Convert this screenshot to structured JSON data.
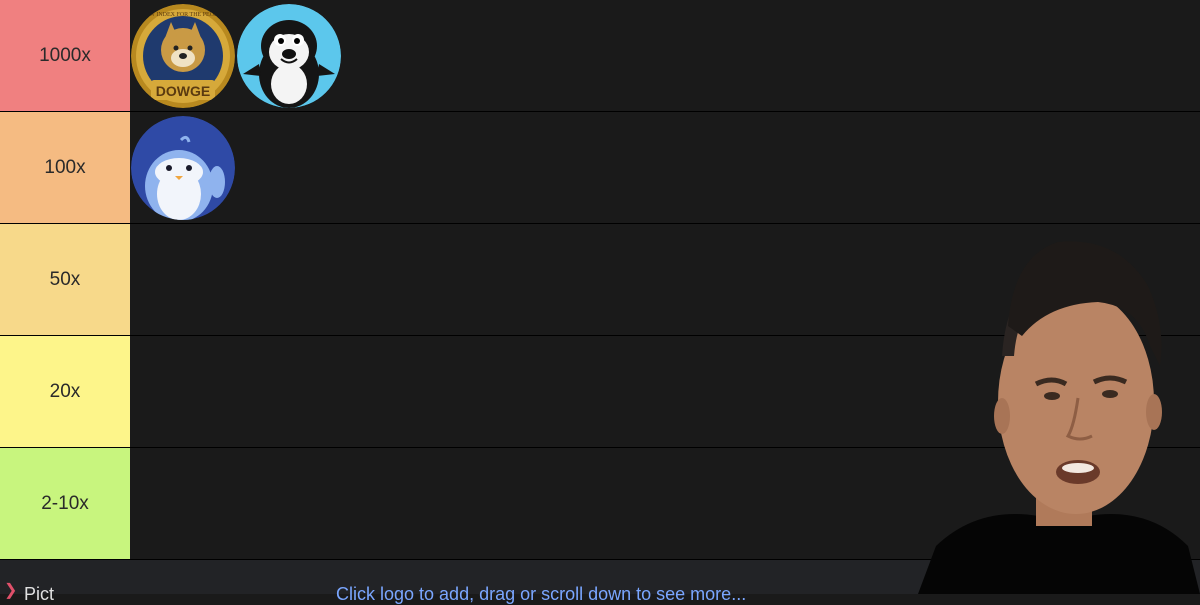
{
  "tiers": [
    {
      "label": "1000x",
      "color": "#f08080",
      "tokens": [
        {
          "name": "dowge-token-icon",
          "text": "DOWGE",
          "ring_text": "NEW INDEX FOR THE PEOPLE"
        },
        {
          "name": "penguin-black-token-icon"
        }
      ]
    },
    {
      "label": "100x",
      "color": "#f5bb82",
      "tokens": [
        {
          "name": "pudgy-penguin-token-icon"
        }
      ]
    },
    {
      "label": "50x",
      "color": "#f7d98a",
      "tokens": []
    },
    {
      "label": "20x",
      "color": "#fdf58a",
      "tokens": []
    },
    {
      "label": "2-10x",
      "color": "#c8f57e",
      "tokens": []
    }
  ],
  "bottom_bar": {
    "label": "Pict",
    "hint": "Click logo to add, drag or scroll down to see more..."
  },
  "webcam": {
    "icon": "presenter-webcam"
  }
}
